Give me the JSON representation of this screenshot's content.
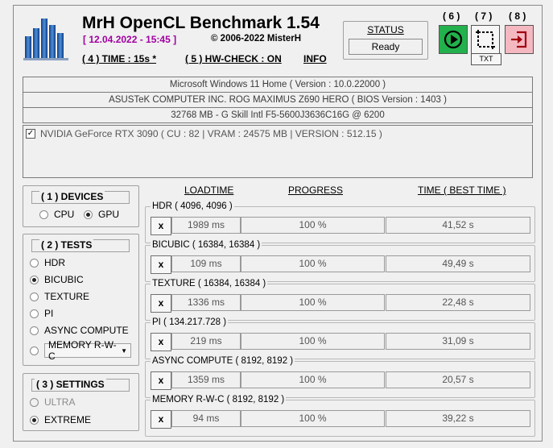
{
  "header": {
    "app_title": "MrH OpenCL Benchmark 1.54",
    "datetime": "[ 12.04.2022 - 15:45 ]",
    "copyright": "©  2006-2022 MisterH",
    "time_setting": "( 4 ) TIME : 15s *",
    "hw_check": "( 5 ) HW-CHECK : ON",
    "info": "INFO"
  },
  "status": {
    "label": "STATUS",
    "value": "Ready"
  },
  "toolbar": {
    "run_num": "( 6 )",
    "capture_num": "( 7 )",
    "exit_num": "( 8 )",
    "capture_sublabel": "TXT"
  },
  "system_info": [
    "Microsoft Windows 11 Home ( Version : 10.0.22000 )",
    "ASUSTeK COMPUTER INC. ROG MAXIMUS Z690 HERO ( BIOS Version : 1403 )",
    "32768 MB - G Skill Intl F5-5600J3636C16G      @ 6200"
  ],
  "device_list": [
    {
      "label": "NVIDIA GeForce RTX 3090 ( CU : 82 | VRAM : 24575 MB | VERSION : 512.15 )",
      "checked": true
    }
  ],
  "devices": {
    "title": "( 1 ) DEVICES",
    "options": [
      {
        "label": "CPU",
        "selected": false
      },
      {
        "label": "GPU",
        "selected": true
      }
    ]
  },
  "tests": {
    "title": "( 2 ) TESTS",
    "options": [
      {
        "label": "HDR",
        "selected": false
      },
      {
        "label": "BICUBIC",
        "selected": true
      },
      {
        "label": "TEXTURE",
        "selected": false
      },
      {
        "label": "PI",
        "selected": false
      },
      {
        "label": "ASYNC COMPUTE",
        "selected": false
      },
      {
        "label": "MEMORY R-W-C",
        "selected": false
      }
    ]
  },
  "settings": {
    "title": "( 3 ) SETTINGS",
    "options": [
      {
        "label": "ULTRA",
        "selected": false,
        "disabled": true
      },
      {
        "label": "EXTREME",
        "selected": true,
        "disabled": false
      }
    ]
  },
  "columns": {
    "loadtime": "LOADTIME",
    "progress": "PROGRESS",
    "time": "TIME ( BEST TIME )"
  },
  "benchmarks": [
    {
      "title": "HDR ( 4096, 4096 )",
      "button": "x",
      "loadtime": "1989 ms",
      "progress": "100 %",
      "time": "41,52 s"
    },
    {
      "title": "BICUBIC ( 16384, 16384 )",
      "button": "x",
      "loadtime": "109 ms",
      "progress": "100 %",
      "time": "49,49 s"
    },
    {
      "title": "TEXTURE ( 16384, 16384 )",
      "button": "x",
      "loadtime": "1336 ms",
      "progress": "100 %",
      "time": "22,48 s"
    },
    {
      "title": "PI ( 134.217.728 )",
      "button": "x",
      "loadtime": "219 ms",
      "progress": "100 %",
      "time": "31,09 s"
    },
    {
      "title": "ASYNC COMPUTE ( 8192, 8192 )",
      "button": "x",
      "loadtime": "1359 ms",
      "progress": "100 %",
      "time": "20,57 s"
    },
    {
      "title": "MEMORY R-W-C ( 8192, 8192 )",
      "button": "x",
      "loadtime": "94 ms",
      "progress": "100 %",
      "time": "39,22 s"
    }
  ],
  "colors": {
    "accent_purple": "#a000a0",
    "run_green": "#22b14c",
    "exit_pink": "#f4b8c0",
    "logo_blue": "#1f5aa6"
  }
}
